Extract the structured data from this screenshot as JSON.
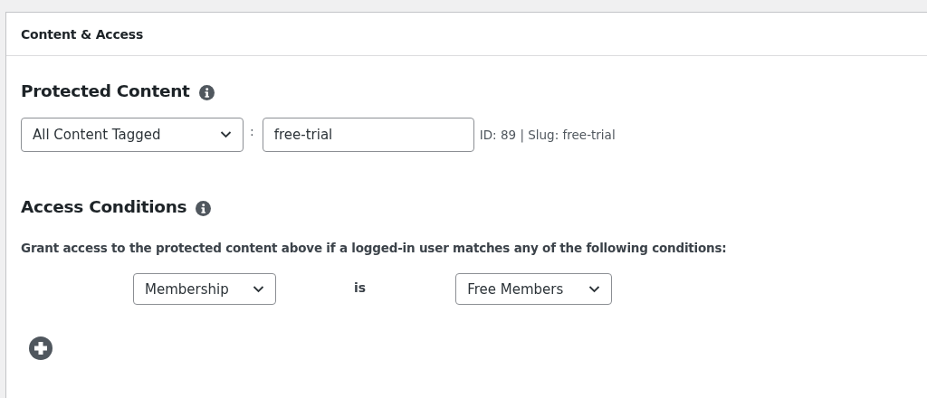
{
  "panel": {
    "title": "Content & Access"
  },
  "protected_content": {
    "heading": "Protected Content",
    "content_type": "All Content Tagged",
    "separator": ":",
    "tag_value": "free-trial",
    "tag_info": "ID: 89 | Slug: free-trial"
  },
  "access_conditions": {
    "heading": "Access Conditions",
    "description": "Grant access to the protected content above if a logged-in user matches any of the following conditions:",
    "conditions": [
      {
        "field": "Membership",
        "operator": "is",
        "value": "Free Members"
      }
    ]
  }
}
